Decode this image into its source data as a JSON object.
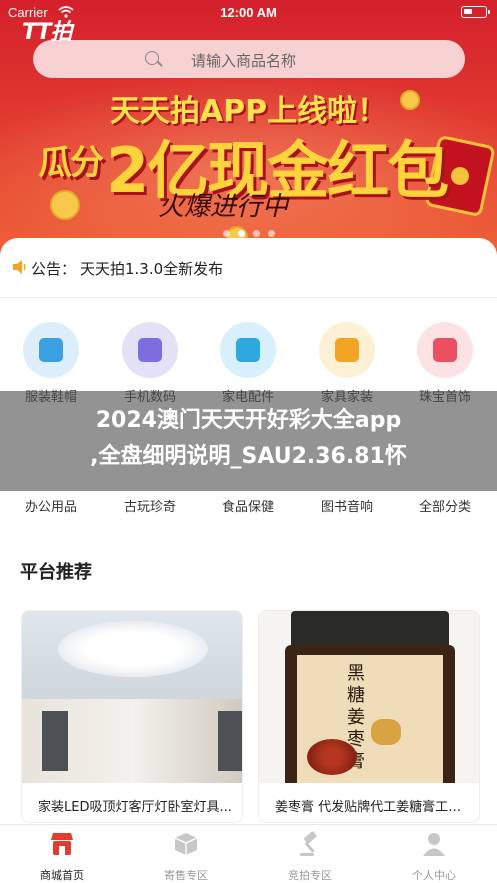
{
  "status_bar": {
    "carrier": "Carrier",
    "time": "12:00 AM"
  },
  "header": {
    "logo": "TT拍",
    "search_placeholder": "请输入商品名称"
  },
  "banner": {
    "line1": "天天拍APP上线啦！",
    "line2_prefix": "瓜分",
    "line2_main": "2亿现金红包",
    "line3": "火爆进行中",
    "slide_count": 4,
    "active_slide": 1
  },
  "notice": {
    "label": "公告：",
    "text": "天天拍1.3.0全新发布"
  },
  "categories_row1": [
    {
      "label": "服装鞋帽",
      "icon": "tshirt-icon",
      "color": "#dbeefa",
      "glyph": "#3aa0e0"
    },
    {
      "label": "手机数码",
      "icon": "phone-icon",
      "color": "#e4e1f7",
      "glyph": "#7b6fe0"
    },
    {
      "label": "家电配件",
      "icon": "camera-icon",
      "color": "#d8f0fb",
      "glyph": "#2fa8de"
    },
    {
      "label": "家具家装",
      "icon": "house-icon",
      "color": "#fdf0d4",
      "glyph": "#f2a425"
    },
    {
      "label": "珠宝首饰",
      "icon": "bear-icon",
      "color": "#fde2e4",
      "glyph": "#ec4f62"
    }
  ],
  "categories_row2": [
    {
      "label": "办公用品",
      "icon": "printer-icon"
    },
    {
      "label": "古玩珍奇",
      "icon": "vase-icon"
    },
    {
      "label": "食品保健",
      "icon": "food-icon"
    },
    {
      "label": "图书音响",
      "icon": "book-icon"
    },
    {
      "label": "全部分类",
      "icon": "grid-icon"
    }
  ],
  "watermark": {
    "line1": "2024澳门天天开好彩大全app",
    "line2": ",全盘细明说明_SAU2.36.81怀"
  },
  "section_title": "平台推荐",
  "products": [
    {
      "title": "家装LED吸顶灯客厅灯卧室灯具...",
      "image": "ceiling-lamp-photo"
    },
    {
      "title": "姜枣膏 代发贴牌代工姜糖膏工厂...",
      "image": "ginger-jar-photo",
      "jar_text": "黑糖姜枣膏"
    }
  ],
  "tabbar": [
    {
      "label": "商城首页",
      "icon": "store-icon",
      "active": true,
      "color": "#e23b2f"
    },
    {
      "label": "寄售专区",
      "icon": "box-icon",
      "active": false,
      "color": "#c7c7c7"
    },
    {
      "label": "竞拍专区",
      "icon": "gavel-icon",
      "active": false,
      "color": "#c7c7c7"
    },
    {
      "label": "个人中心",
      "icon": "user-icon",
      "active": false,
      "color": "#c7c7c7"
    }
  ]
}
